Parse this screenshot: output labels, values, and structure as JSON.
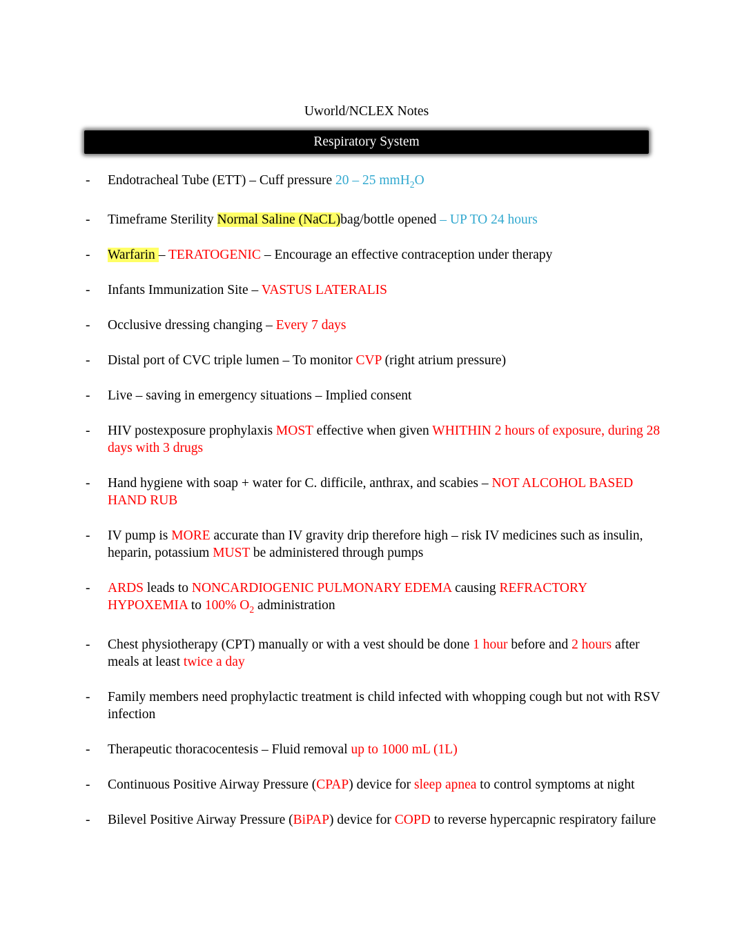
{
  "document": {
    "title": "Uworld/NCLEX Notes",
    "section_banner": "Respiratory System",
    "bullet_marker": "-",
    "colors": {
      "red": "#ff0000",
      "blue": "#31a8cf",
      "highlight": "#ffff66",
      "banner_bg": "#000000"
    },
    "items": [
      {
        "id": "ett-cuff-pressure",
        "parts": [
          {
            "text": "Endotracheal Tube (ETT)",
            "style": "plain"
          },
          {
            "text": " – Cuff pressure ",
            "style": "plain"
          },
          {
            "text": "20 – 25 mmH",
            "style": "blue"
          },
          {
            "text": "2",
            "style": "blue-sub"
          },
          {
            "text": "O",
            "style": "blue"
          }
        ]
      },
      {
        "id": "normal-saline-sterility",
        "parts": [
          {
            "text": "Timeframe Sterility ",
            "style": "plain"
          },
          {
            "text": "Normal Saline (NaCL)",
            "style": "highlight"
          },
          {
            "text": "bag/bottle opened ",
            "style": "plain"
          },
          {
            "text": " – UP TO 24 hours",
            "style": "blue"
          }
        ]
      },
      {
        "id": "warfarin-teratogenic",
        "parts": [
          {
            "text": "Warfarin ",
            "style": "highlight"
          },
          {
            "text": " – ",
            "style": "plain"
          },
          {
            "text": "TERATOGENIC",
            "style": "red"
          },
          {
            "text": " – Encourage an effective contraception under therapy",
            "style": "plain"
          }
        ]
      },
      {
        "id": "infant-immunization-site",
        "parts": [
          {
            "text": "Infants Immunization Site  – ",
            "style": "plain"
          },
          {
            "text": "VASTUS LATERALIS",
            "style": "red"
          }
        ]
      },
      {
        "id": "occlusive-dressing",
        "parts": [
          {
            "text": "Occlusive dressing changing – ",
            "style": "plain"
          },
          {
            "text": "Every 7 days",
            "style": "red"
          }
        ]
      },
      {
        "id": "cvc-distal-port",
        "parts": [
          {
            "text": "Distal port of CVC triple lumen – To monitor ",
            "style": "plain"
          },
          {
            "text": "CVP",
            "style": "red"
          },
          {
            "text": " (right atrium pressure)",
            "style": "plain"
          }
        ]
      },
      {
        "id": "implied-consent",
        "parts": [
          {
            "text": "Live – saving in emergency situations – Implied consent",
            "style": "plain"
          }
        ]
      },
      {
        "id": "hiv-postexposure-prophylaxis",
        "parts": [
          {
            "text": "HIV postexposure prophylaxis ",
            "style": "plain"
          },
          {
            "text": "MOST",
            "style": "red"
          },
          {
            "text": " effective when given ",
            "style": "plain"
          },
          {
            "text": "WHITHIN 2 hours of exposure, during 28 days with 3 drugs",
            "style": "red"
          }
        ]
      },
      {
        "id": "hand-hygiene-soap-water",
        "parts": [
          {
            "text": "Hand hygiene with soap + water for C. difficile, anthrax, and scabies – ",
            "style": "plain"
          },
          {
            "text": "NOT ALCOHOL BASED HAND RUB",
            "style": "red"
          }
        ]
      },
      {
        "id": "iv-pump-accuracy",
        "parts": [
          {
            "text": "IV pump is ",
            "style": "plain"
          },
          {
            "text": "MORE",
            "style": "red"
          },
          {
            "text": " accurate than IV gravity drip therefore high – risk IV medicines such as insulin, heparin, potassium  ",
            "style": "plain"
          },
          {
            "text": "MUST",
            "style": "red"
          },
          {
            "text": " be administered through pumps",
            "style": "plain"
          }
        ]
      },
      {
        "id": "ards-pulmonary-edema",
        "parts": [
          {
            "text": "ARDS",
            "style": "red"
          },
          {
            "text": " leads to ",
            "style": "plain"
          },
          {
            "text": "NONCARDIOGENIC PULMONARY EDEMA",
            "style": "red"
          },
          {
            "text": " causing ",
            "style": "plain"
          },
          {
            "text": "REFRACTORY HYPOXEMIA",
            "style": "red"
          },
          {
            "text": " to ",
            "style": "plain"
          },
          {
            "text": "100% O",
            "style": "red"
          },
          {
            "text": "2",
            "style": "red-sub"
          },
          {
            "text": " administration",
            "style": "plain"
          }
        ]
      },
      {
        "id": "chest-physiotherapy",
        "parts": [
          {
            "text": "Chest physiotherapy (CPT) manually or with a vest should be done ",
            "style": "plain"
          },
          {
            "text": "1 hour",
            "style": "red"
          },
          {
            "text": " before and ",
            "style": "plain"
          },
          {
            "text": "2 hours",
            "style": "red"
          },
          {
            "text": " after meals at least ",
            "style": "plain"
          },
          {
            "text": " twice a day",
            "style": "red"
          }
        ]
      },
      {
        "id": "whooping-cough-prophylaxis",
        "parts": [
          {
            "text": "Family members need prophylactic treatment is child infected with whopping cough but not with RSV infection",
            "style": "plain"
          }
        ]
      },
      {
        "id": "therapeutic-thoracocentesis",
        "parts": [
          {
            "text": "Therapeutic thoracocentesis – Fluid removal ",
            "style": "plain"
          },
          {
            "text": " up to 1000 mL (1L)",
            "style": "red"
          }
        ]
      },
      {
        "id": "cpap-sleep-apnea",
        "parts": [
          {
            "text": "Continuous Positive Airway Pressure (",
            "style": "plain"
          },
          {
            "text": "CPAP",
            "style": "red"
          },
          {
            "text": ") device for ",
            "style": "plain"
          },
          {
            "text": "sleep apnea",
            "style": "red"
          },
          {
            "text": "  to control symptoms at night",
            "style": "plain"
          }
        ]
      },
      {
        "id": "bipap-copd",
        "parts": [
          {
            "text": "Bilevel Positive Airway Pressure (",
            "style": "plain"
          },
          {
            "text": "BiPAP",
            "style": "red"
          },
          {
            "text": ") device for ",
            "style": "plain"
          },
          {
            "text": "COPD",
            "style": "red"
          },
          {
            "text": " to reverse hypercapnic respiratory failure",
            "style": "plain"
          }
        ]
      }
    ]
  }
}
